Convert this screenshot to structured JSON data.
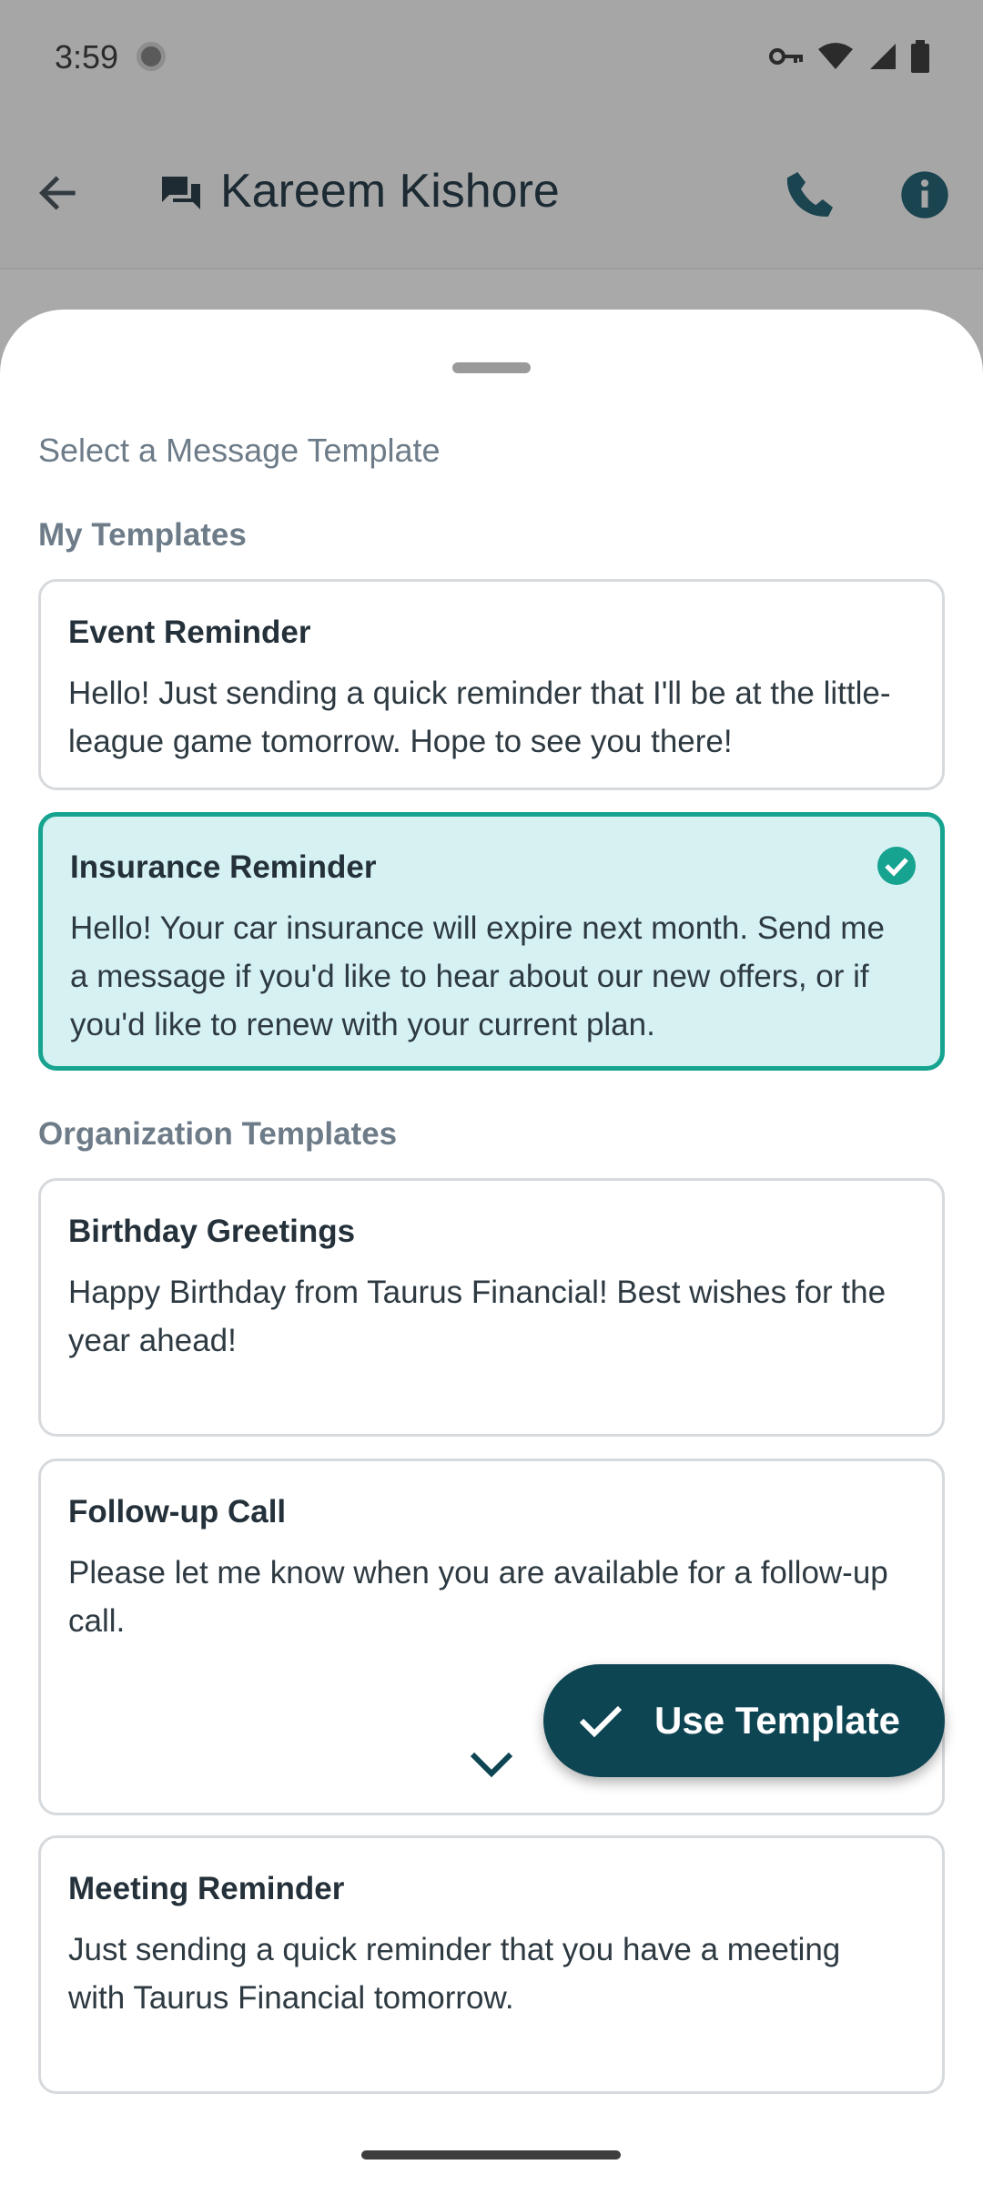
{
  "status_bar": {
    "time": "3:59"
  },
  "app_bar": {
    "contact_name": "Kareem Kishore"
  },
  "sheet": {
    "title": "Select a Message Template",
    "my_templates_label": "My Templates",
    "org_templates_label": "Organization Templates",
    "my_templates": [
      {
        "title": "Event Reminder",
        "body": "Hello! Just sending a quick reminder that I'll be at the little-league game tomorrow. Hope to see you there!",
        "selected": false
      },
      {
        "title": "Insurance Reminder",
        "body": "Hello! Your car insurance will expire next month. Send me a message if you'd like to hear about our new offers, or if you'd like to renew with your current plan.",
        "selected": true
      }
    ],
    "org_templates": [
      {
        "title": "Birthday Greetings",
        "body": "Happy Birthday from Taurus Financial! Best wishes for the year ahead!"
      },
      {
        "title": "Follow-up Call",
        "body": "Please let me know when you are available for a follow-up call."
      },
      {
        "title": "Meeting Reminder",
        "body": "Just sending a quick reminder that you have a meeting with Taurus Financial tomorrow."
      }
    ],
    "use_button_label": "Use Template"
  },
  "icons": {
    "status": [
      "key-icon",
      "wifi-icon",
      "signal-icon",
      "battery-icon"
    ],
    "app_bar": [
      "back-arrow-icon",
      "chat-icon",
      "phone-icon",
      "info-icon"
    ],
    "sheet": [
      "check-circle-icon",
      "chevron-down-icon",
      "checkmark-icon"
    ]
  },
  "colors": {
    "accent": "#16a390",
    "selected_background": "#d6f1f2",
    "primary_dark": "#0e4553"
  }
}
